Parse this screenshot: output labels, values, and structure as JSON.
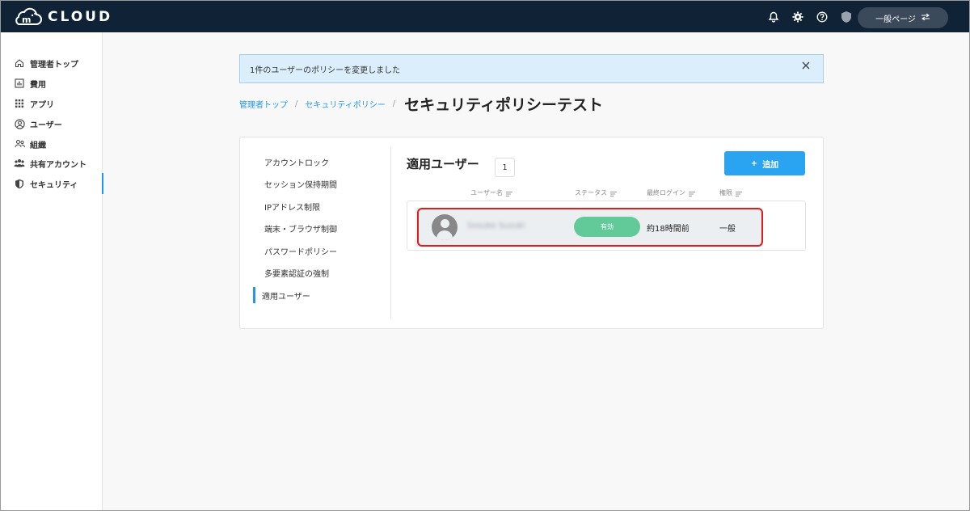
{
  "header": {
    "logo_text": "CLOUD",
    "general_page_label": "一般ページ"
  },
  "sidebar": {
    "items": [
      {
        "label": "管理者トップ",
        "icon": "home-icon"
      },
      {
        "label": "費用",
        "icon": "chart-icon"
      },
      {
        "label": "アプリ",
        "icon": "grid-icon"
      },
      {
        "label": "ユーザー",
        "icon": "user-circle-icon"
      },
      {
        "label": "組織",
        "icon": "group-icon"
      },
      {
        "label": "共有アカウント",
        "icon": "shared-users-icon"
      },
      {
        "label": "セキュリティ",
        "icon": "shield-icon",
        "active": true
      }
    ]
  },
  "alert": {
    "message": "1件のユーザーのポリシーを変更しました",
    "close": "×"
  },
  "breadcrumb": {
    "home": "管理者トップ",
    "parent": "セキュリティポリシー",
    "separator": "/",
    "title": "セキュリティポリシーテスト"
  },
  "submenu": {
    "items": [
      "アカウントロック",
      "セッション保持期間",
      "IPアドレス制限",
      "端末・ブラウザ制御",
      "パスワードポリシー",
      "多要素認証の強制",
      "適用ユーザー"
    ],
    "active_index": 6
  },
  "section": {
    "title": "適用ユーザー",
    "count": "1",
    "add_button": "追加",
    "add_plus": "+"
  },
  "table": {
    "columns": [
      "ユーザー名",
      "ステータス",
      "最終ログイン",
      "権限"
    ],
    "rows": [
      {
        "name": "Sosuke Suzuki",
        "status": "有効",
        "last_login": "約18時間前",
        "role": "一般"
      }
    ]
  },
  "colors": {
    "header_bg": "#0f2236",
    "accent": "#2196f3",
    "status_active": "#62c998",
    "highlight": "#e41b1b"
  }
}
